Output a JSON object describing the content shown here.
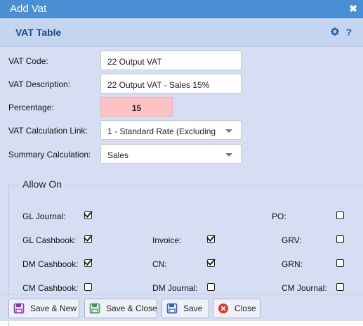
{
  "window": {
    "title": "Add Vat",
    "close_glyph": "✖"
  },
  "header": {
    "title": "VAT Table",
    "icons": [
      "gear-icon",
      "help-icon"
    ]
  },
  "form": {
    "vat_code": {
      "label": "VAT Code:",
      "value": "22 Output VAT"
    },
    "vat_description": {
      "label": "VAT Description:",
      "value": "22 Output VAT - Sales 15%"
    },
    "percentage": {
      "label": "Percentage:",
      "value": "15"
    },
    "vat_calc_link": {
      "label": "VAT Calculation Link:",
      "value": "1 - Standard Rate (Excluding"
    },
    "summary_calc": {
      "label": "Summary Calculation:",
      "value": "Sales"
    }
  },
  "allow_on": {
    "legend": "Allow On",
    "items": [
      {
        "label": "GL Journal:",
        "checked": true
      },
      {
        "label": "PO:",
        "checked": false
      },
      {
        "label": "GL Cashbook:",
        "checked": true
      },
      {
        "label": "Invoice:",
        "checked": true
      },
      {
        "label": "GRV:",
        "checked": false
      },
      {
        "label": "DM Cashbook:",
        "checked": true
      },
      {
        "label": "CN:",
        "checked": true
      },
      {
        "label": "GRN:",
        "checked": false
      },
      {
        "label": "CM Cashbook:",
        "checked": false
      },
      {
        "label": "DM Journal:",
        "checked": false
      },
      {
        "label": "CM Journal:",
        "checked": false
      }
    ]
  },
  "buttons": {
    "save_new": "Save & New",
    "save_close": "Save & Close",
    "save": "Save",
    "close": "Close"
  },
  "colors": {
    "titlebar": "#4a8fd4",
    "subheader": "#c4d6ef",
    "dialog_bg": "#d6def4",
    "percentage_bg": "#fcc3c3",
    "save_new_icon": "#8a36c4",
    "save_close_icon": "#3f9b47",
    "save_icon": "#2f64b8",
    "close_icon": "#d93a2d"
  }
}
